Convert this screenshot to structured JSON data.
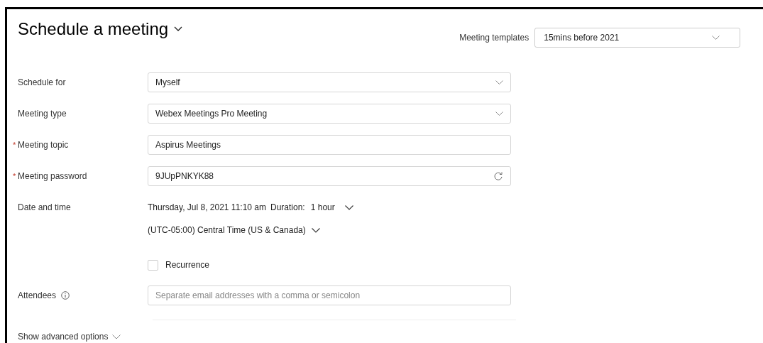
{
  "title": "Schedule a meeting",
  "templates": {
    "label": "Meeting templates",
    "value": "15mins before 2021"
  },
  "fields": [
    {
      "kind": "select",
      "label": "Schedule for",
      "value": "Myself"
    },
    {
      "kind": "select",
      "label": "Meeting type",
      "value": "Webex Meetings Pro Meeting"
    },
    {
      "kind": "text",
      "required_mark": "*",
      "label": "Meeting topic",
      "value": "Aspirus Meetings"
    },
    {
      "kind": "password",
      "required_mark": "*",
      "label": "Meeting password",
      "value": "9JUpPNKYK88"
    },
    {
      "kind": "datetime",
      "label": "Date and time",
      "date": "Thursday, Jul 8, 2021 11:10 am",
      "duration_label": "Duration:",
      "duration": "1 hour",
      "timezone": "(UTC-05:00) Central Time (US & Canada)",
      "recurrence": {
        "label": "Recurrence",
        "checked": false
      }
    },
    {
      "kind": "attendees",
      "label": "Attendees",
      "placeholder": "Separate email addresses with a comma or semicolon"
    }
  ],
  "advanced": {
    "label": "Show advanced options"
  }
}
